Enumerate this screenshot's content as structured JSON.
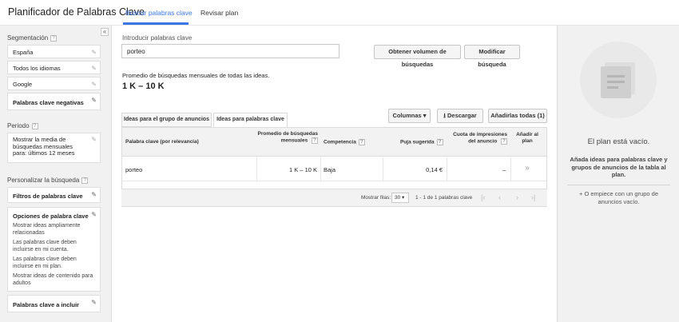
{
  "header": {
    "title": "Planificador de Palabras Clave",
    "tabs": [
      {
        "label": "Buscar palabras clave"
      },
      {
        "label": "Revisar plan"
      }
    ]
  },
  "sidebar": {
    "collapse_glyph": "«",
    "segmentation": {
      "title": "Segmentación",
      "items": [
        "España",
        "Todos los idiomas",
        "Google",
        "Palabras clave negativas"
      ]
    },
    "period": {
      "title": "Periodo",
      "value": "Mostrar la media de búsquedas mensuales para: últimos 12 meses"
    },
    "customize": {
      "title": "Personalizar la búsqueda",
      "filters": "Filtros de palabras clave",
      "options_title": "Opciones de palabra clave",
      "options": [
        "Mostrar ideas ampliamente relacionadas",
        "Las palabras clave deben incluirse en mi cuenta.",
        "Las palabras clave deben incluirse en mi plan.",
        "Mostrar ideas de contenido para adultos"
      ],
      "include": "Palabras clave a incluir"
    }
  },
  "main": {
    "input_label": "Introducir palabras clave",
    "input_value": "porteo",
    "get_volume_btn": "Obtener volumen de búsquedas",
    "modify_btn": "Modificar búsqueda",
    "avg_label": "Promedio de búsquedas mensuales de todas las ideas.",
    "avg_value": "1 K – 10 K",
    "tabs": [
      "Ideas para el grupo de anuncios",
      "Ideas para palabras clave"
    ],
    "columns_btn": "Columnas",
    "download_btn": "Descargar",
    "add_all_btn": "Añadirlas todas (1)",
    "table": {
      "headers": {
        "keyword": "Palabra clave (por relevancia)",
        "avg": "Promedio de búsquedas mensuales",
        "competition": "Competencia",
        "bid": "Puja sugerida",
        "impr": "Cuota de impresiones del anuncio",
        "add": "Añadir al plan"
      },
      "rows": [
        {
          "keyword": "porteo",
          "avg": "1 K – 10 K",
          "competition": "Baja",
          "bid": "0,14 €",
          "impr": "–",
          "add": "»"
        }
      ]
    },
    "pager": {
      "show_rows_label": "Mostrar filas:",
      "rows_value": "30",
      "range": "1 - 1 de 1 palabras clave"
    }
  },
  "right_panel": {
    "empty_title": "El plan está vacío.",
    "text": "Añada ideas para palabras clave y grupos de anuncios de la tabla al plan.",
    "alt": "+ O empiece con un grupo de anuncios vacío."
  }
}
